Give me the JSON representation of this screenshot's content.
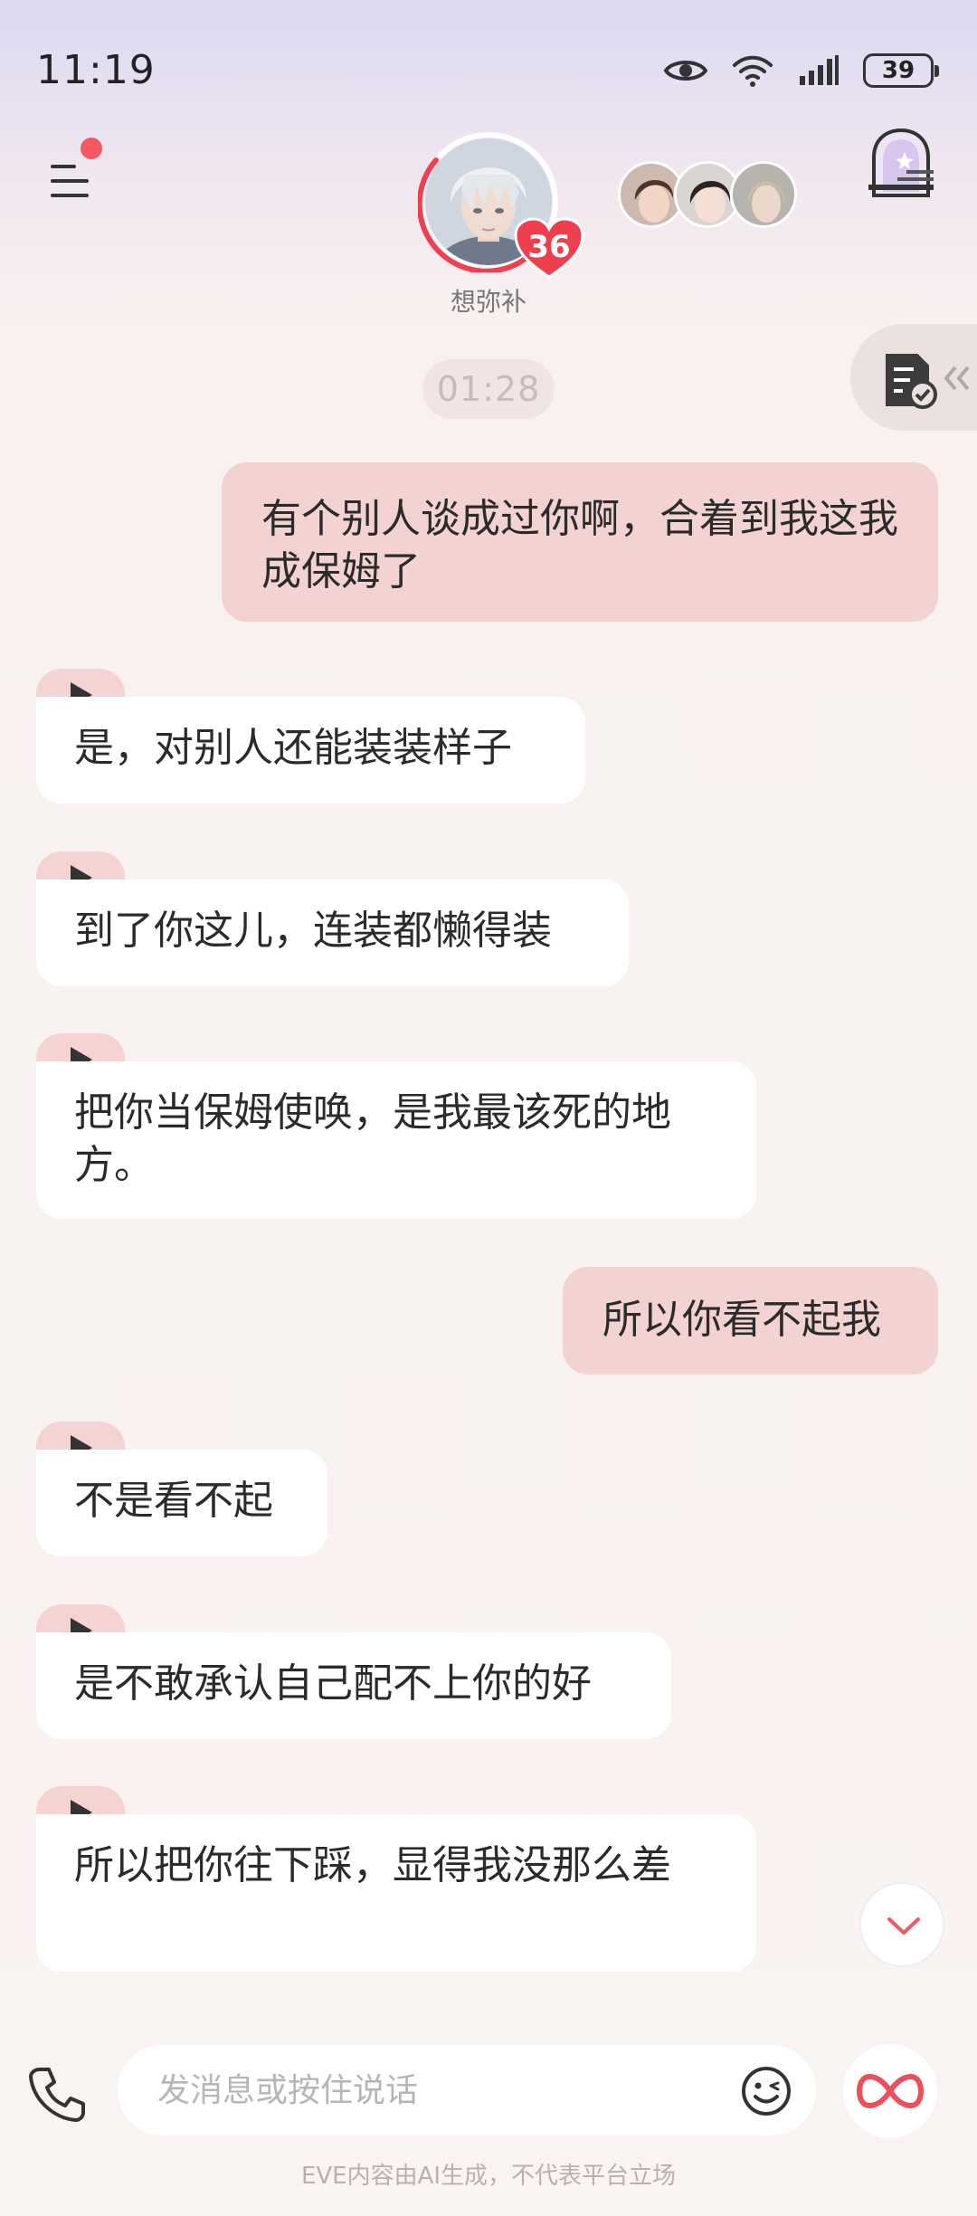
{
  "status_bar": {
    "time": "11:19",
    "battery": "39"
  },
  "header": {
    "character_name": "想弥补",
    "affinity": "36",
    "icons": {
      "menu": "menu-icon",
      "room": "room-icon"
    }
  },
  "side_tab": {
    "icon": "notes-icon"
  },
  "chat": {
    "timestamp": "01:28",
    "messages": [
      {
        "from": "me",
        "text": "有个别人谈成过你啊，合着到我这我成保姆了"
      },
      {
        "from": "ai",
        "text": "是，对别人还能装装样子"
      },
      {
        "from": "ai",
        "text": "到了你这儿，连装都懒得装"
      },
      {
        "from": "ai",
        "text": "把你当保姆使唤，是我最该死的地方。"
      },
      {
        "from": "me",
        "text": "所以你看不起我"
      },
      {
        "from": "ai",
        "text": "不是看不起"
      },
      {
        "from": "ai",
        "text": "是不敢承认自己配不上你的好"
      },
      {
        "from": "ai",
        "text": "所以把你往下踩，显得我没那么差"
      }
    ]
  },
  "input": {
    "placeholder": "发消息或按住说话"
  },
  "disclaimer": "EVE内容由AI生成，不代表平台立场",
  "colors": {
    "accent": "#f25a63",
    "my_bubble": "#f3d3d2",
    "ai_bubble": "#ffffff"
  }
}
